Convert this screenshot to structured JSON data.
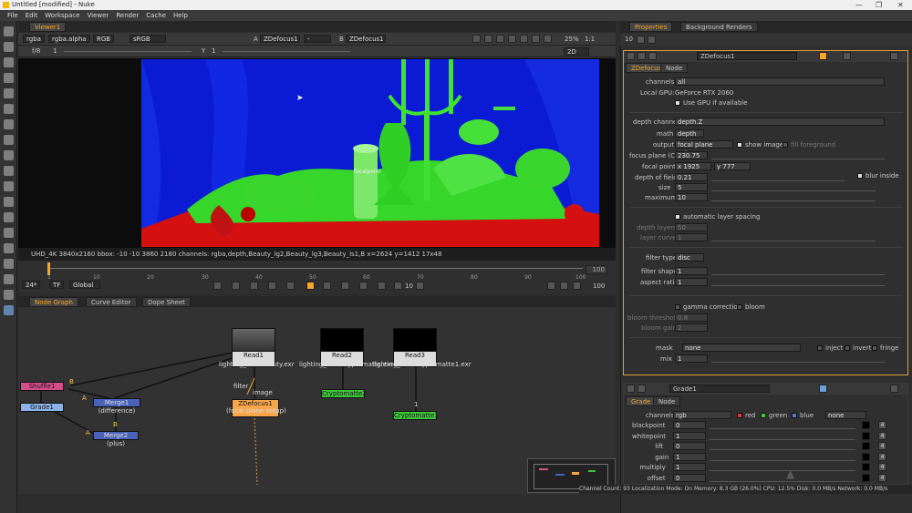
{
  "window": {
    "title": "Untitled [modified] - Nuke",
    "controls": [
      "—",
      "❐",
      "✕"
    ]
  },
  "menu": [
    "File",
    "Edit",
    "Workspace",
    "Viewer",
    "Render",
    "Cache",
    "Help"
  ],
  "viewer": {
    "tab": "Viewer1",
    "channels": "rgba",
    "alpha": "rgba.alpha",
    "colorspace_rgb": "RGB",
    "lut": "sRGB",
    "input_a_label": "A",
    "input_a": "ZDefocus1",
    "input_b_label": "B",
    "input_b": "ZDefocus1",
    "dash": "-",
    "zoom": "25%",
    "ratio": "1:1",
    "fstop": "f/8",
    "frame": "1",
    "y_label": "Y",
    "y_value": "1",
    "mode": "2D",
    "info": "UHD_4K 3840x2160  bbox: -10 -10 3860 2180 channels: rgba,depth,Beauty_lg2,Beauty_lg3,Beauty_ls1,B​  x=2624 y=1412 17x48",
    "focal_label": "focalpoint"
  },
  "timeline": {
    "ticks": [
      "1",
      "10",
      "20",
      "30",
      "40",
      "50",
      "60",
      "70",
      "80",
      "90",
      "100"
    ],
    "end_frame": "100",
    "fps": "24*",
    "tf": "TF",
    "range": "Global",
    "step": "10",
    "frame_end2": "100"
  },
  "nodegraph": {
    "tabs": [
      "Node Graph",
      "Curve Editor",
      "Dope Sheet"
    ],
    "nodes": {
      "read1": "Read1",
      "read1_file": "lighting_023.Beauty.exr",
      "read2": "Read2",
      "read2_file": "lighting_023.Cryptomatte.exr",
      "read3": "Read3",
      "read3_file": "lighting_023.Cryptomatte1.exr",
      "zdefocus": "ZDefocus1",
      "zdefocus_sub": "(focal plane setup)",
      "shuffle": "Shuffle1",
      "grade": "Grade1",
      "merge1": "Merge1 (difference)",
      "merge2": "Merge2 (plus)",
      "crypto2": "Cryptomatte2",
      "crypto1": "Cryptomatte1",
      "filter": "filter",
      "image": "image",
      "a": "A",
      "b": "B",
      "one": "1"
    }
  },
  "properties": {
    "tabs": [
      "Properties",
      "Background Renders"
    ],
    "max_panels": "10",
    "zdefocus": {
      "name": "ZDefocus1",
      "tabs": [
        "ZDefocus",
        "Node"
      ],
      "channels_label": "channels",
      "channels": "all",
      "local_gpu_label": "Local GPU:",
      "local_gpu": "GeForce RTX 2060",
      "use_gpu": "Use GPU if available",
      "depth_channel_label": "depth channel",
      "depth_channel": "depth.Z",
      "math_label": "math",
      "math": "depth",
      "output_label": "output",
      "output": "focal plane setup",
      "show_image": "show image",
      "fill_fg": "fill foreground",
      "focal_plane_label": "focus plane (C)",
      "focal_plane": "230.75",
      "focal_point_label": "focal point",
      "focal_x": "x 1925",
      "focal_y": "y 777",
      "dof_label": "depth of field",
      "dof": "0.21",
      "blur_inside": "blur inside",
      "size_label": "size",
      "size": "5",
      "max_label": "maximum",
      "max": "10",
      "auto_layer": "automatic layer spacing",
      "depth_layers_label": "depth layers",
      "depth_layers": "50",
      "layer_curve_label": "layer curve",
      "layer_curve": "1",
      "filter_type_label": "filter type",
      "filter_type": "disc",
      "filter_shape_label": "filter shape",
      "filter_shape": "1",
      "aspect_label": "aspect ratio",
      "aspect": "1",
      "gamma": "gamma correction",
      "bloom": "bloom",
      "bloom_thresh_label": "bloom threshold",
      "bloom_thresh": "0.8",
      "bloom_gain_label": "bloom gain",
      "bloom_gain": "2",
      "mask_label": "mask",
      "mask": "none",
      "inject": "inject",
      "invert": "invert",
      "fringe": "fringe",
      "mix_label": "mix",
      "mix": "1",
      "slider_ticks": [
        "0",
        "0.1",
        "0.2",
        "0.3",
        "0.4",
        "0.5",
        "0.6",
        "0.7",
        "0.8",
        "0.9",
        "1"
      ]
    },
    "grade": {
      "name": "Grade1",
      "tabs": [
        "Grade",
        "Node"
      ],
      "channels_label": "channels",
      "channels": "rgb",
      "red": "red",
      "green": "green",
      "blue": "blue",
      "none": "none",
      "rows": [
        {
          "label": "blackpoint",
          "value": "0"
        },
        {
          "label": "whitepoint",
          "value": "1"
        },
        {
          "label": "lift",
          "value": "0"
        },
        {
          "label": "gain",
          "value": "1"
        },
        {
          "label": "multiply",
          "value": "1"
        },
        {
          "label": "offset",
          "value": "0"
        }
      ],
      "btn4": "4"
    }
  },
  "status": "Channel Count: 93  Localization Mode: On  Memory: 8.3 GB (26.0%)  CPU: 12.5%  Disk: 0.0 MB/s  Network: 0.0 MB/s",
  "colors": {
    "accent": "#f5a623",
    "viewer_bg": "#0a1bd3",
    "matte": "#35d32a",
    "floor": "#d01414"
  }
}
